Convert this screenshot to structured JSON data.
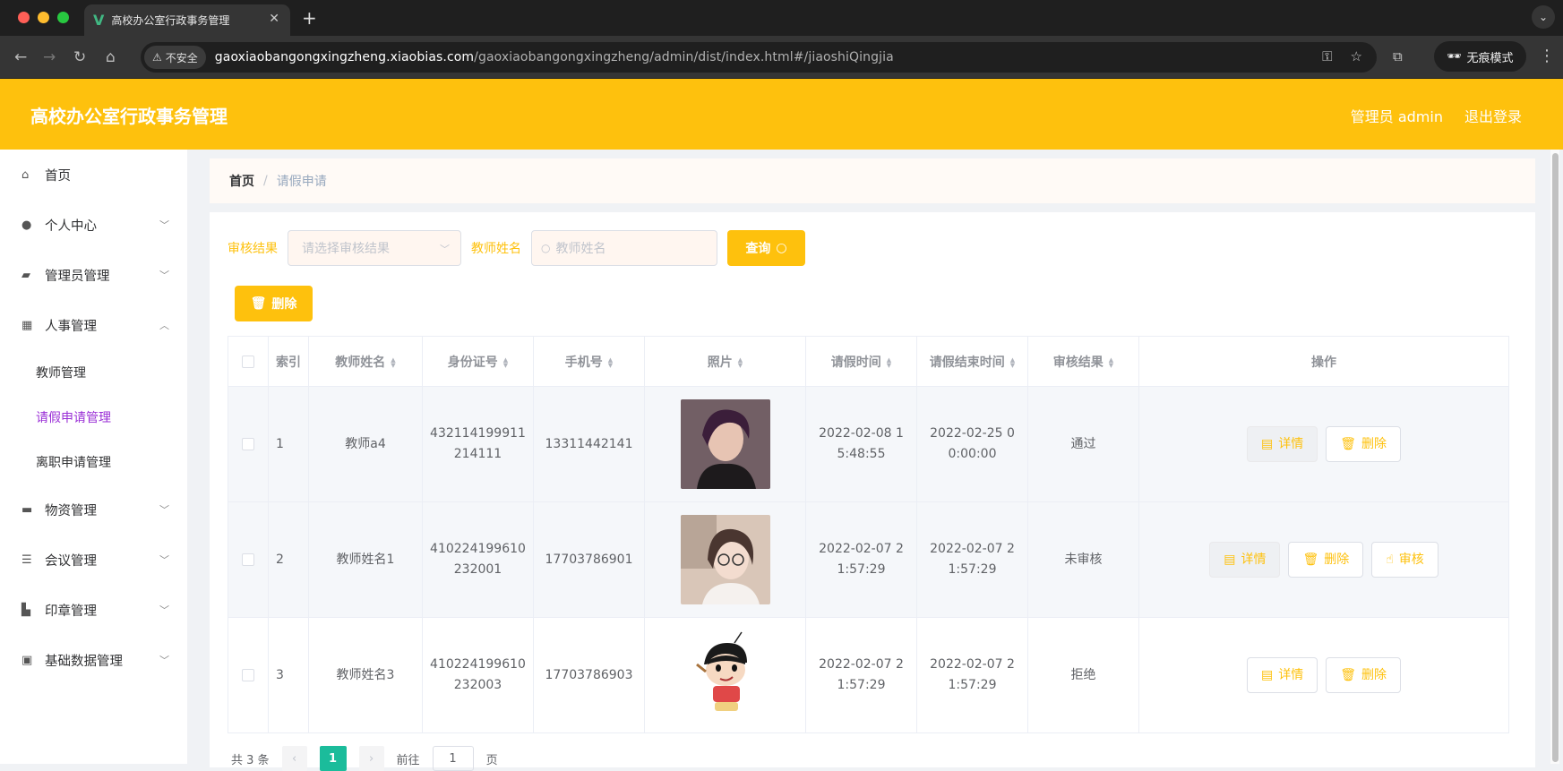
{
  "browser": {
    "tab_title": "高校办公室行政事务管理",
    "insecure_label": "不安全",
    "url_host": "gaoxiaobangongxingzheng.xiaobias.com",
    "url_path": "/gaoxiaobangongxingzheng/admin/dist/index.html#/jiaoshiQingjia",
    "incognito_label": "无痕模式"
  },
  "header": {
    "title": "高校办公室行政事务管理",
    "user_label": "管理员 admin",
    "logout_label": "退出登录",
    "accent_color": "#fec10d"
  },
  "sidebar": {
    "items": [
      {
        "label": "首页",
        "icon": "home-icon"
      },
      {
        "label": "个人中心",
        "icon": "user-icon"
      },
      {
        "label": "管理员管理",
        "icon": "ticket-icon"
      },
      {
        "label": "人事管理",
        "icon": "grid-icon"
      },
      {
        "label": "物资管理",
        "icon": "chat-icon"
      },
      {
        "label": "会议管理",
        "icon": "list-icon"
      },
      {
        "label": "印章管理",
        "icon": "stamp-icon"
      },
      {
        "label": "基础数据管理",
        "icon": "clipboard-icon"
      }
    ],
    "sub_items": [
      {
        "label": "教师管理"
      },
      {
        "label": "请假申请管理"
      },
      {
        "label": "离职申请管理"
      }
    ],
    "active_color": "#9a2fd6"
  },
  "breadcrumb": {
    "home": "首页",
    "sep": "/",
    "current": "请假申请"
  },
  "filters": {
    "result_label": "审核结果",
    "result_placeholder": "请选择审核结果",
    "name_label": "教师姓名",
    "name_placeholder": "教师姓名",
    "query_label": "查询"
  },
  "toolbar": {
    "delete_label": "删除"
  },
  "table": {
    "headers": [
      "索引",
      "教师姓名",
      "身份证号",
      "手机号",
      "照片",
      "请假时间",
      "请假结束时间",
      "审核结果",
      "操作"
    ],
    "rows": [
      {
        "index": "1",
        "name": "教师a4",
        "id_number": "432114199911214111",
        "phone": "13311442141",
        "photo": "portrait-male",
        "start": "2022-02-08 15:48:55",
        "end": "2022-02-25 00:00:00",
        "result": "通过",
        "actions": [
          "详情",
          "删除"
        ]
      },
      {
        "index": "2",
        "name": "教师姓名1",
        "id_number": "410224199610232001",
        "phone": "17703786901",
        "photo": "portrait-female",
        "start": "2022-02-07 21:57:29",
        "end": "2022-02-07 21:57:29",
        "result": "未审核",
        "actions": [
          "详情",
          "删除",
          "审核"
        ]
      },
      {
        "index": "3",
        "name": "教师姓名3",
        "id_number": "410224199610232003",
        "phone": "17703786903",
        "photo": "cartoon-boy",
        "start": "2022-02-07 21:57:29",
        "end": "2022-02-07 21:57:29",
        "result": "拒绝",
        "actions": [
          "详情",
          "删除"
        ]
      }
    ]
  },
  "pagination": {
    "total": "共 3 条",
    "current_page": "1",
    "goto_label": "前往",
    "goto_value": "1",
    "page_suffix": "页"
  }
}
